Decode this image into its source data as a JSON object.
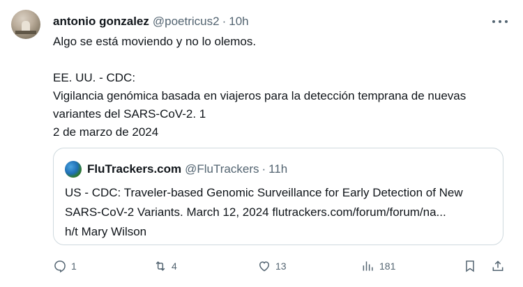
{
  "post": {
    "author_name": "antonio gonzalez",
    "author_handle": "@poetricus2",
    "separator": "·",
    "time": "10h",
    "lines": [
      "Algo se está moviendo y no lo olemos.",
      "EE. UU. - CDC:",
      "Vigilancia genómica basada en viajeros para la detección temprana de nuevas",
      "variantes del SARS-CoV-2. 1",
      "2 de marzo de 2024"
    ]
  },
  "quote": {
    "author_name": "FluTrackers.com",
    "author_handle": "@FluTrackers",
    "separator": "·",
    "time": "11h",
    "lines": [
      "US - CDC: Traveler-based Genomic Surveillance for Early Detection of New",
      "SARS-CoV-2 Variants. March 12, 2024 flutrackers.com/forum/forum/na...",
      "h/t Mary Wilson"
    ]
  },
  "actions": {
    "replies": "1",
    "reposts": "4",
    "likes": "13",
    "views": "181"
  },
  "icons": {
    "reply": "reply-icon",
    "repost": "repost-icon",
    "like": "heart-icon",
    "views": "views-icon",
    "bookmark": "bookmark-icon",
    "share": "share-icon",
    "more": "more-icon"
  }
}
